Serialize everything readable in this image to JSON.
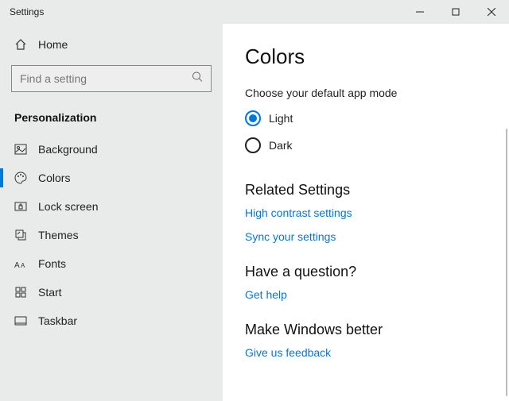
{
  "window": {
    "title": "Settings"
  },
  "sidebar": {
    "home_label": "Home",
    "search_placeholder": "Find a setting",
    "category": "Personalization",
    "items": [
      {
        "label": "Background"
      },
      {
        "label": "Colors"
      },
      {
        "label": "Lock screen"
      },
      {
        "label": "Themes"
      },
      {
        "label": "Fonts"
      },
      {
        "label": "Start"
      },
      {
        "label": "Taskbar"
      }
    ]
  },
  "content": {
    "title": "Colors",
    "mode_label": "Choose your default app mode",
    "options": {
      "light": "Light",
      "dark": "Dark"
    },
    "related": {
      "heading": "Related Settings",
      "links": {
        "high_contrast": "High contrast settings",
        "sync": "Sync your settings"
      }
    },
    "question": {
      "heading": "Have a question?",
      "link": "Get help"
    },
    "feedback": {
      "heading": "Make Windows better",
      "link": "Give us feedback"
    }
  }
}
